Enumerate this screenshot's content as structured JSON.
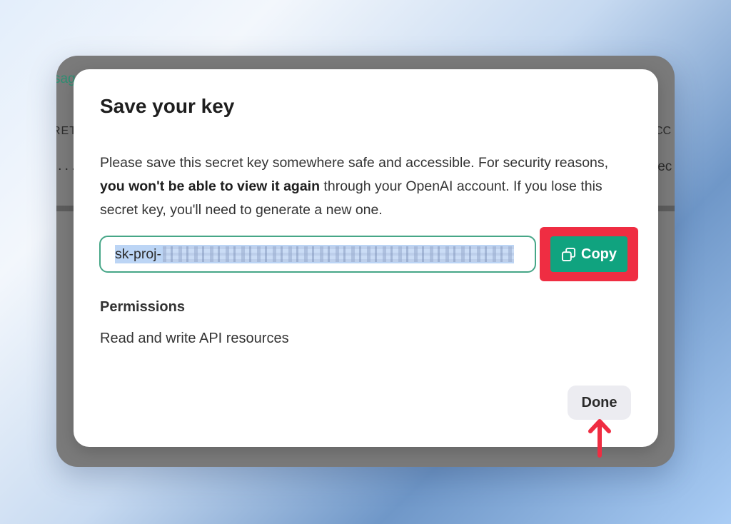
{
  "background": {
    "link_fragment": "sag",
    "col_left_fragment": "RET",
    "col_right_fragment": "CC",
    "cell_left_fragment": "...",
    "cell_right_fragment": "jec"
  },
  "modal": {
    "title": "Save your key",
    "description": {
      "before": "Please save this secret key somewhere safe and accessible. For security reasons, ",
      "bold": "you won't be able to view it again",
      "after": " through your OpenAI account. If you lose this secret key, you'll need to generate a new one."
    },
    "key_field": {
      "value_prefix": "sk-proj-",
      "value_masked": true
    },
    "copy_button": {
      "label": "Copy",
      "icon": "copy-icon"
    },
    "permissions": {
      "label": "Permissions",
      "value": "Read and write API resources"
    },
    "done_button": {
      "label": "Done"
    }
  },
  "annotations": {
    "highlight_color": "#ef2d42",
    "arrow_icon": "up-arrow-icon"
  },
  "colors": {
    "accent_green": "#10a37f",
    "field_border": "#46a687",
    "selection_blue": "#bcd5f5"
  }
}
